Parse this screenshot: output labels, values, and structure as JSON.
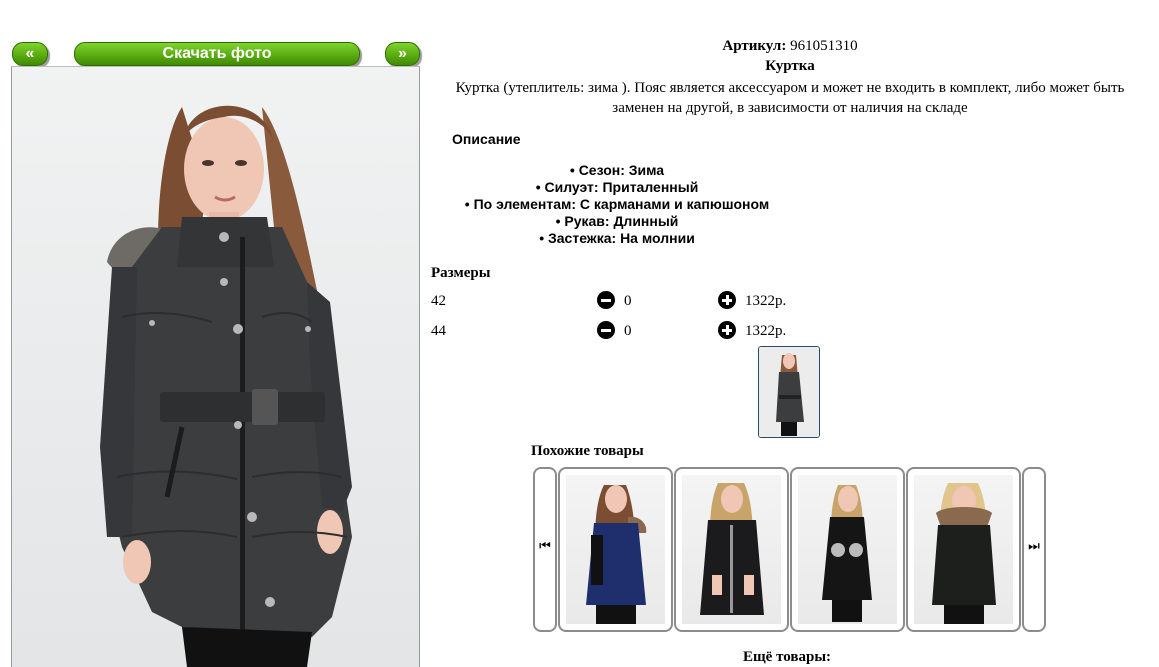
{
  "gallery": {
    "prev_label": "«",
    "download_label": "Скачать фото",
    "next_label": "»"
  },
  "product": {
    "article_label": "Артикул:",
    "article_value": "961051310",
    "name": "Куртка",
    "description": "Куртка (утеплитель: зима ). Пояс является аксессуаром и может не входить в комплект, либо может быть заменен на другой, в зависимости от наличия на складе"
  },
  "description_section": {
    "heading": "Описание",
    "features": [
      "Сезон: Зима",
      "Силуэт: Приталенный",
      "По элементам: С карманами и капюшоном",
      "Рукав: Длинный",
      "Застежка: На молнии"
    ]
  },
  "sizes": {
    "heading": "Размеры",
    "rows": [
      {
        "size": "42",
        "qty": "0",
        "price": "1322р."
      },
      {
        "size": "44",
        "qty": "0",
        "price": "1322р."
      }
    ]
  },
  "similar": {
    "heading": "Похожие товары",
    "prev_icon": "first-page-icon",
    "next_icon": "last-page-icon",
    "items": [
      {
        "jacket_color": "#1f2f6e",
        "fur": true
      },
      {
        "jacket_color": "#1b1b1d",
        "fur": false
      },
      {
        "jacket_color": "#151515",
        "fur": false
      },
      {
        "jacket_color": "#1c1f1c",
        "fur": true
      }
    ]
  },
  "more": {
    "heading": "Ещё товары:"
  },
  "colors": {
    "button_green": "#5aac10",
    "jacket_main": "#3b3d3f",
    "thumb_border": "#2a4a6a"
  }
}
